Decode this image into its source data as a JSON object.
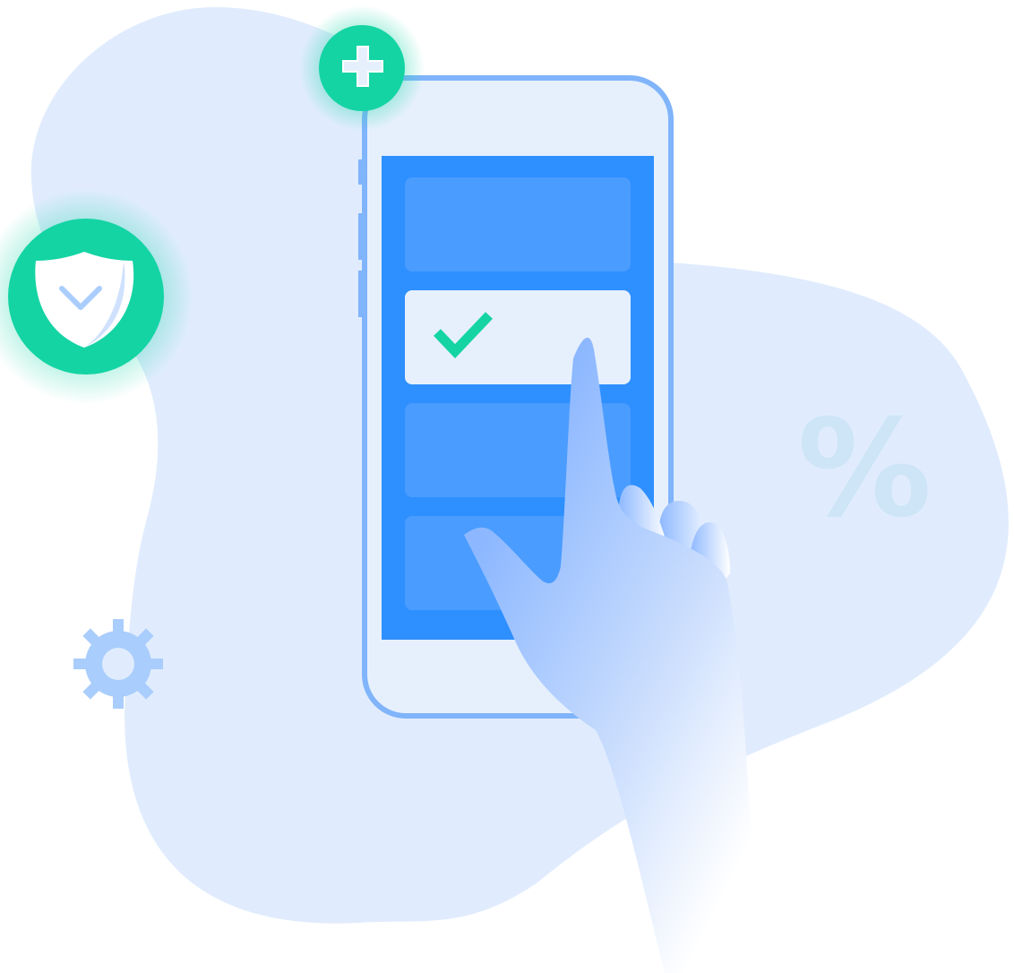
{
  "illustration": {
    "percent_symbol": "%",
    "icons": [
      "plus-icon",
      "shield-check-icon",
      "gear-icon",
      "checkmark-icon",
      "pointing-hand-icon",
      "smartphone-icon"
    ],
    "selected_card_index": 1,
    "card_count": 4
  },
  "colors": {
    "background_blob": "#e0ecfd",
    "phone_outline": "#80b4fb",
    "phone_body": "#e6f0fd",
    "screen": "#2e8fff",
    "card": "#4a9cff",
    "accent_green": "#14d4a4",
    "gear": "#a9cdfc",
    "percent": "#cde5f7",
    "hand": "#8db8ff"
  }
}
